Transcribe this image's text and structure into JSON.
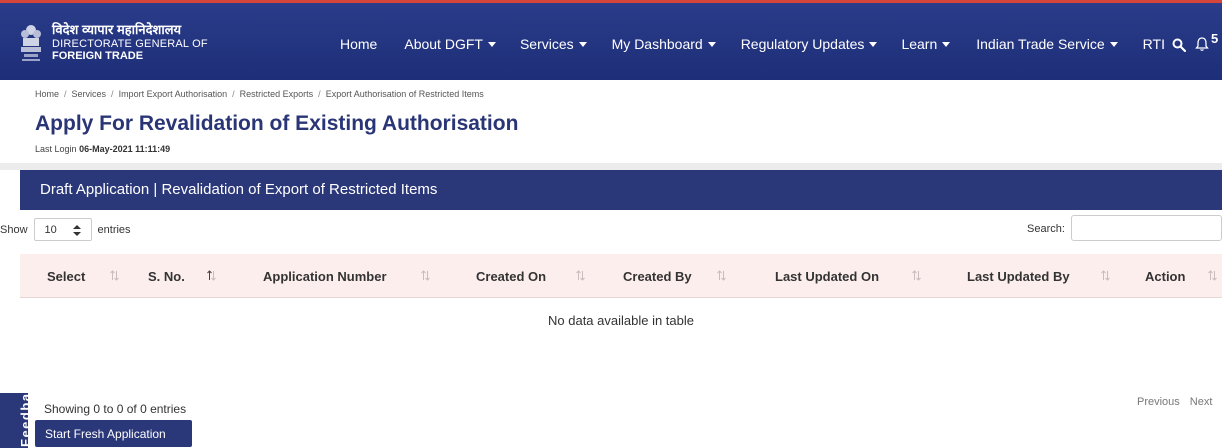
{
  "header": {
    "brand_hindi": "विदेश व्यापार महानिदेशालय",
    "brand_line2": "DIRECTORATE GENERAL OF",
    "brand_line3": "FOREIGN TRADE",
    "nav": [
      {
        "label": "Home",
        "dropdown": false
      },
      {
        "label": "About DGFT",
        "dropdown": true
      },
      {
        "label": "Services",
        "dropdown": true
      },
      {
        "label": "My Dashboard",
        "dropdown": true
      },
      {
        "label": "Regulatory Updates",
        "dropdown": true
      },
      {
        "label": "Learn",
        "dropdown": true
      },
      {
        "label": "Indian Trade Service",
        "dropdown": true
      },
      {
        "label": "RTI",
        "dropdown": false
      }
    ],
    "notification_count": "5",
    "icons": {
      "search": "search-icon",
      "notifications": "bell-icon"
    }
  },
  "breadcrumb": [
    "Home",
    "Services",
    "Import Export Authorisation",
    "Restricted Exports",
    "Export Authorisation of Restricted Items"
  ],
  "breadcrumb_separator": "/",
  "page_title": "Apply For Revalidation of Existing Authorisation",
  "last_login": {
    "label": "Last Login",
    "value": "06-May-2021 11:11:49"
  },
  "card_title": "Draft Application | Revalidation of Export of Restricted Items",
  "table": {
    "show_label": "Show",
    "entries_value": "10",
    "entries_label": "entries",
    "search_label": "Search:",
    "search_value": "",
    "columns": [
      "Select",
      "S. No.",
      "Application Number",
      "Created On",
      "Created By",
      "Last Updated On",
      "Last Updated By",
      "Action"
    ],
    "empty_message": "No data available in table",
    "info": "Showing 0 to 0 of 0 entries",
    "previous_label": "Previous",
    "next_label": "Next"
  },
  "start_button_label": "Start Fresh Application",
  "feedback_label": "Feedback",
  "colors": {
    "primary": "#2a3779",
    "nav_top_border": "#d6453a",
    "table_header_bg": "#fdeeee"
  }
}
